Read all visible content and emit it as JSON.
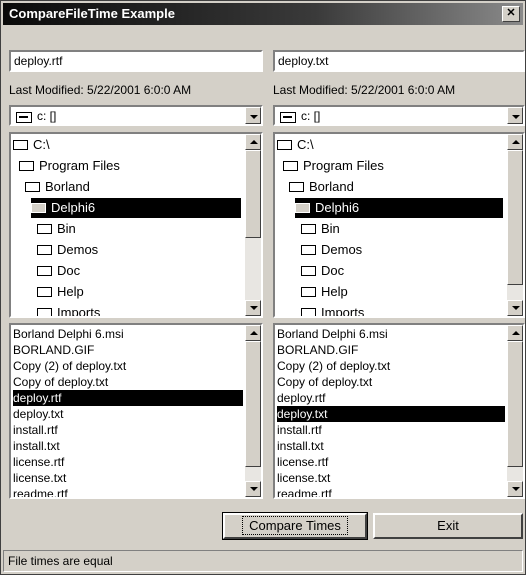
{
  "window": {
    "title": "CompareFileTime Example",
    "close_label": "✕"
  },
  "left": {
    "filename": "deploy.rtf",
    "last_modified": "Last Modified: 5/22/2001  6:0:0 AM",
    "drive": "c: []",
    "folders": [
      "C:\\",
      "Program Files",
      "Borland",
      "Delphi6",
      "Bin",
      "Demos",
      "Doc",
      "Help",
      "Imports"
    ],
    "folder_selected": 3,
    "files": [
      "Borland Delphi 6.msi",
      "BORLAND.GIF",
      "Copy (2) of deploy.txt",
      "Copy of deploy.txt",
      "deploy.rtf",
      "deploy.txt",
      "install.rtf",
      "install.txt",
      "license.rtf",
      "license.txt",
      "readme.rtf"
    ],
    "file_selected": 4
  },
  "right": {
    "filename": "deploy.txt",
    "last_modified": "Last Modified: 5/22/2001  6:0:0 AM",
    "drive": "c: []",
    "folders": [
      "C:\\",
      "Program Files",
      "Borland",
      "Delphi6",
      "Bin",
      "Demos",
      "Doc",
      "Help",
      "Imports"
    ],
    "folder_selected": 3,
    "files": [
      "Borland Delphi 6.msi",
      "BORLAND.GIF",
      "Copy (2) of deploy.txt",
      "Copy of deploy.txt",
      "deploy.rtf",
      "deploy.txt",
      "install.rtf",
      "install.txt",
      "license.rtf",
      "license.txt",
      "readme.rtf"
    ],
    "file_selected": 5
  },
  "buttons": {
    "compare": "Compare Times",
    "exit": "Exit"
  },
  "status": "File times are equal"
}
